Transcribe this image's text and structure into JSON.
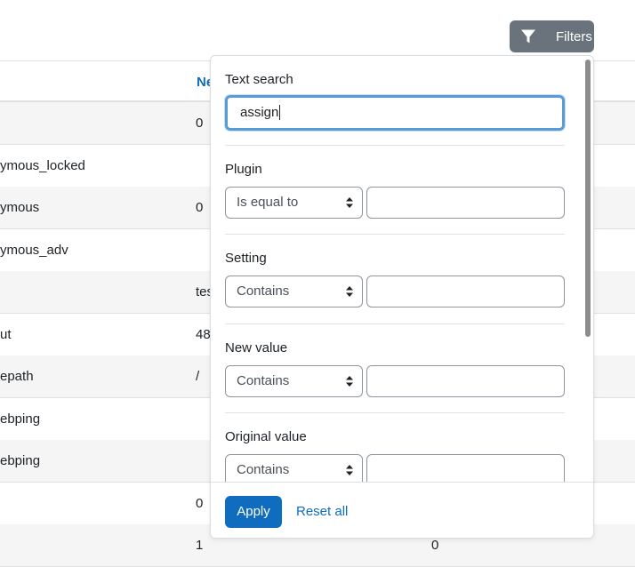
{
  "table": {
    "header": "Ne",
    "rows": [
      {
        "c1": "",
        "c2": "0",
        "c3": ""
      },
      {
        "c1": "ymous_locked",
        "c2": "",
        "c3": ""
      },
      {
        "c1": "ymous",
        "c2": "0",
        "c3": ""
      },
      {
        "c1": "ymous_adv",
        "c2": "",
        "c3": ""
      },
      {
        "c1": "",
        "c2": "tes",
        "c3": ""
      },
      {
        "c1": "ut",
        "c2": "48",
        "c3": ""
      },
      {
        "c1": "epath",
        "c2": "/",
        "c3": ""
      },
      {
        "c1": "ebping",
        "c2": "",
        "c3": ""
      },
      {
        "c1": "ebping",
        "c2": "",
        "c3": ""
      },
      {
        "c1": "",
        "c2": "0",
        "c3": ""
      },
      {
        "c1": "",
        "c2": "1",
        "c3": "0"
      }
    ]
  },
  "filters_button": {
    "label": "Filters"
  },
  "panel": {
    "text_search": {
      "label": "Text search",
      "value": "assign"
    },
    "plugin": {
      "label": "Plugin",
      "operator": "Is equal to",
      "value": ""
    },
    "setting": {
      "label": "Setting",
      "operator": "Contains",
      "value": ""
    },
    "new_value": {
      "label": "New value",
      "operator": "Contains",
      "value": ""
    },
    "original_value": {
      "label": "Original value",
      "operator": "Contains",
      "value": ""
    },
    "apply_label": "Apply",
    "reset_label": "Reset all"
  },
  "colors": {
    "primary": "#0f6cbf",
    "secondary_button": "#6a737b"
  },
  "icons": {
    "filter": "filter-icon",
    "select_arrows": "chevron-updown-icon"
  }
}
